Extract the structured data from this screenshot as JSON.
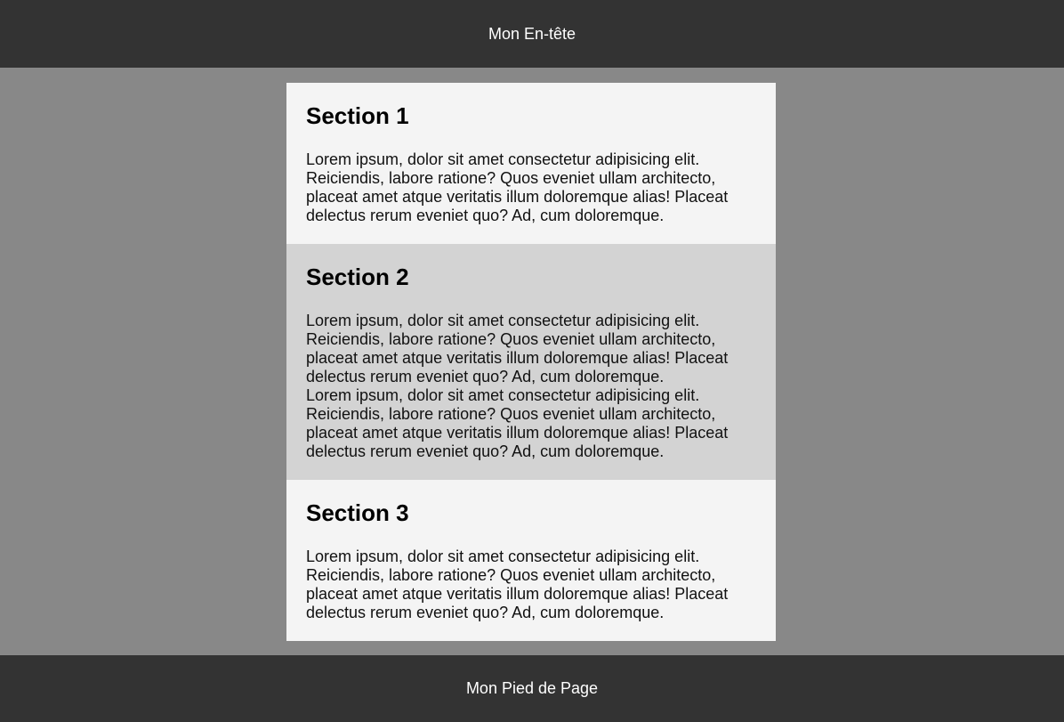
{
  "header": {
    "title": "Mon En-tête"
  },
  "sections": [
    {
      "title": "Section 1",
      "paragraphs": [
        "Lorem ipsum, dolor sit amet consectetur adipisicing elit. Reiciendis, labore ratione? Quos eveniet ullam architecto, placeat amet atque veritatis illum doloremque alias! Placeat delectus rerum eveniet quo? Ad, cum doloremque."
      ]
    },
    {
      "title": "Section 2",
      "paragraphs": [
        "Lorem ipsum, dolor sit amet consectetur adipisicing elit. Reiciendis, labore ratione? Quos eveniet ullam architecto, placeat amet atque veritatis illum doloremque alias! Placeat delectus rerum eveniet quo? Ad, cum doloremque.",
        "Lorem ipsum, dolor sit amet consectetur adipisicing elit. Reiciendis, labore ratione? Quos eveniet ullam architecto, placeat amet atque veritatis illum doloremque alias! Placeat delectus rerum eveniet quo? Ad, cum doloremque."
      ]
    },
    {
      "title": "Section 3",
      "paragraphs": [
        "Lorem ipsum, dolor sit amet consectetur adipisicing elit. Reiciendis, labore ratione? Quos eveniet ullam architecto, placeat amet atque veritatis illum doloremque alias! Placeat delectus rerum eveniet quo? Ad, cum doloremque."
      ]
    }
  ],
  "footer": {
    "text": "Mon Pied de Page"
  },
  "colors": {
    "header_bg": "#333333",
    "page_bg": "#888888",
    "section_light": "#f4f4f4",
    "section_gray": "#d3d3d3"
  }
}
